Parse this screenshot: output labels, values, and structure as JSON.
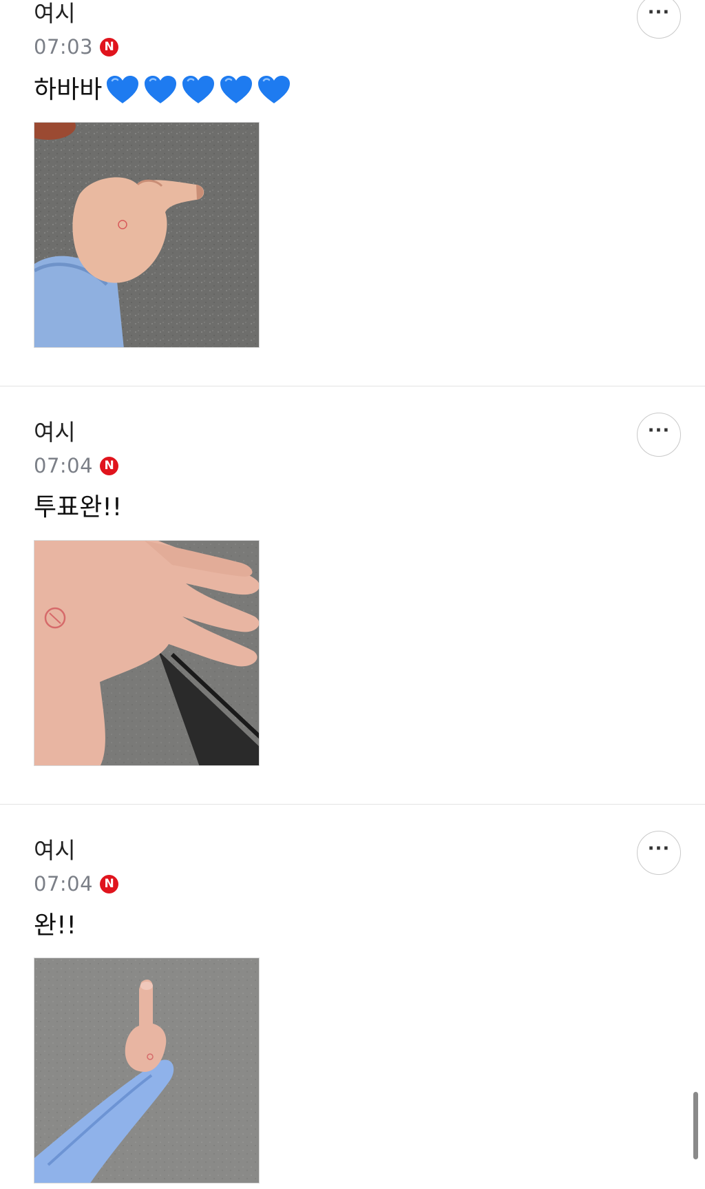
{
  "posts": [
    {
      "author": "여시",
      "time": "07:03",
      "badge": "N",
      "text": "하바바",
      "hearts": 5,
      "more_label": "···"
    },
    {
      "author": "여시",
      "time": "07:04",
      "badge": "N",
      "text": "투표완!!",
      "hearts": 0,
      "more_label": "···"
    },
    {
      "author": "여시",
      "time": "07:04",
      "badge": "N",
      "text": "완!!",
      "hearts": 0,
      "more_label": "···"
    }
  ],
  "icons": {
    "more": "more-horizontal-icon",
    "heart": "blue-heart-emoji",
    "badge": "new-badge-icon"
  },
  "colors": {
    "badge": "#e0141d",
    "time": "#7b7f87",
    "heart": "#1e7bf0",
    "divider": "#e3e3e3"
  }
}
